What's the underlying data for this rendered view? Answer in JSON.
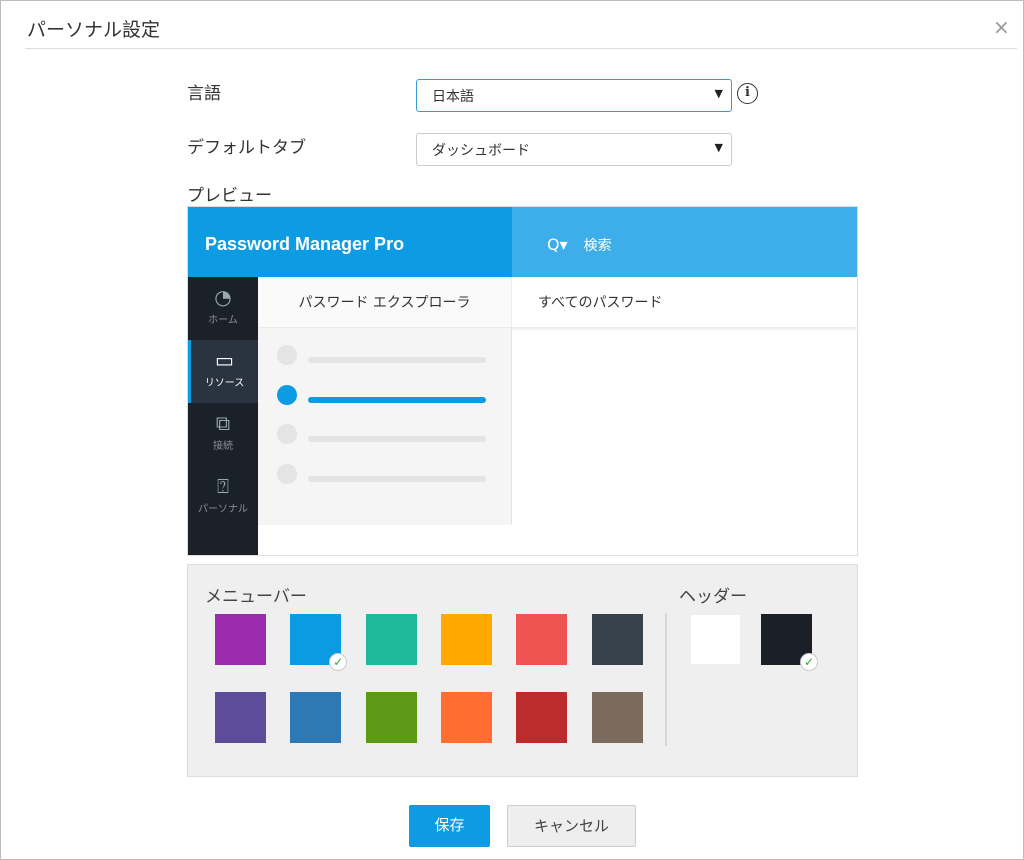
{
  "dialog": {
    "title": "パーソナル設定",
    "close": "×"
  },
  "form": {
    "language_label": "言語",
    "language_value": "日本語",
    "default_tab_label": "デフォルトタブ",
    "default_tab_value": "ダッシュボード",
    "info": "i",
    "preview_label": "プレビュー",
    "arrow": "▼"
  },
  "preview": {
    "logo": "Password Manager Pro",
    "search": "検索",
    "search_icon": "Q▾",
    "sidebar": [
      {
        "label": "ホーム",
        "icon": "◔"
      },
      {
        "label": "リソース",
        "icon": "▭"
      },
      {
        "label": "接続",
        "icon": "⧉"
      },
      {
        "label": "パーソナル",
        "icon": "⍰"
      }
    ],
    "tabs": [
      "パスワード エクスプローラ",
      "すべてのパスワード"
    ]
  },
  "palette": {
    "menubar_label": "メニューバー",
    "header_label": "ヘッダー",
    "check": "✓",
    "menubar_colors": [
      "#9b2cae",
      "#0b9be3",
      "#1fb89a",
      "#ffa800",
      "#ef5453",
      "#37414b",
      "#5c4c9a",
      "#2e78b5",
      "#5c9a16",
      "#ff6e30",
      "#bd2c2d",
      "#7b6b5d"
    ],
    "menubar_selected": 1,
    "header_colors": [
      "#ffffff",
      "#1b1f27"
    ],
    "header_selected": 1
  },
  "buttons": {
    "save": "保存",
    "cancel": "キャンセル"
  }
}
